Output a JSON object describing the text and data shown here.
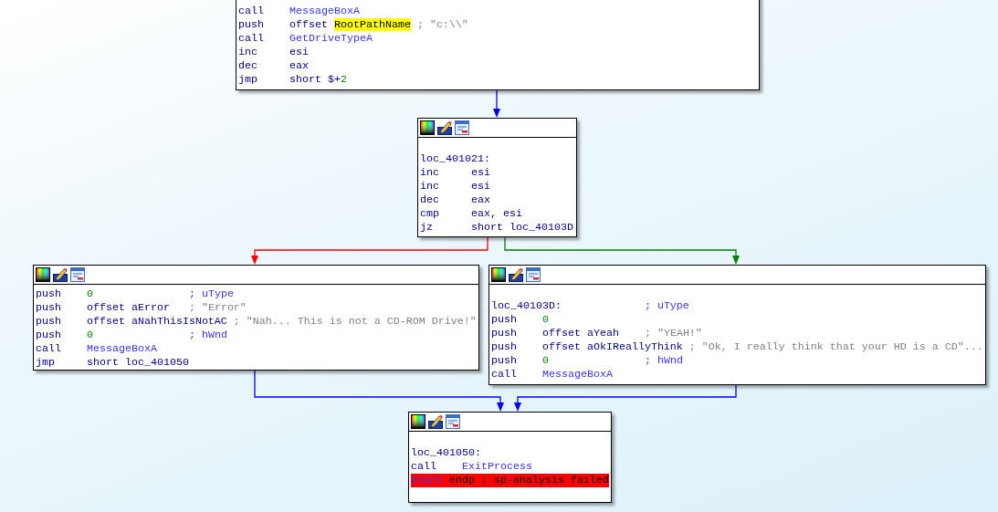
{
  "nodes": [
    {
      "lines": [
        {
          "kind": "instr",
          "mnemonic": "call",
          "operands": [
            {
              "text": "MessageBoxA",
              "kind": "name"
            }
          ]
        },
        {
          "kind": "instr",
          "mnemonic": "push",
          "operands": [
            {
              "text": "offset ",
              "kind": "plain"
            },
            {
              "text": "RootPathName",
              "kind": "highlight"
            }
          ],
          "comment": [
            {
              "text": "; \"c:\\\\\"",
              "kind": "string"
            }
          ]
        },
        {
          "kind": "instr",
          "mnemonic": "call",
          "operands": [
            {
              "text": "GetDriveTypeA",
              "kind": "name"
            }
          ]
        },
        {
          "kind": "instr",
          "mnemonic": "inc",
          "operands": [
            {
              "text": "esi",
              "kind": "plain"
            }
          ]
        },
        {
          "kind": "instr",
          "mnemonic": "dec",
          "operands": [
            {
              "text": "eax",
              "kind": "plain"
            }
          ]
        },
        {
          "kind": "instr",
          "mnemonic": "jmp",
          "operands": [
            {
              "text": "short $+",
              "kind": "plain"
            },
            {
              "text": "2",
              "kind": "number"
            }
          ]
        }
      ]
    },
    {
      "lines": [
        {
          "kind": "label",
          "label": "loc_401021:"
        },
        {
          "kind": "instr",
          "mnemonic": "inc",
          "operands": [
            {
              "text": "esi",
              "kind": "plain"
            }
          ]
        },
        {
          "kind": "instr",
          "mnemonic": "inc",
          "operands": [
            {
              "text": "esi",
              "kind": "plain"
            }
          ]
        },
        {
          "kind": "instr",
          "mnemonic": "dec",
          "operands": [
            {
              "text": "eax",
              "kind": "plain"
            }
          ]
        },
        {
          "kind": "instr",
          "mnemonic": "cmp",
          "operands": [
            {
              "text": "eax, esi",
              "kind": "plain"
            }
          ]
        },
        {
          "kind": "instr",
          "mnemonic": "jz",
          "operands": [
            {
              "text": "short loc_40103D",
              "kind": "plain"
            }
          ]
        }
      ]
    },
    {
      "lines": [
        {
          "kind": "instr",
          "mnemonic": "push",
          "operands": [
            {
              "text": "0",
              "kind": "number"
            }
          ],
          "comment": [
            {
              "text": "; uType",
              "kind": "name"
            }
          ]
        },
        {
          "kind": "instr",
          "mnemonic": "push",
          "operands": [
            {
              "text": "offset aError",
              "kind": "plain"
            }
          ],
          "comment": [
            {
              "text": "; \"Error\"",
              "kind": "string"
            }
          ]
        },
        {
          "kind": "instr",
          "mnemonic": "push",
          "operands": [
            {
              "text": "offset aNahThisIsNotAC",
              "kind": "plain"
            }
          ],
          "comment": [
            {
              "text": "; \"Nah... This is not a CD-ROM Drive!\"",
              "kind": "string"
            }
          ]
        },
        {
          "kind": "instr",
          "mnemonic": "push",
          "operands": [
            {
              "text": "0",
              "kind": "number"
            }
          ],
          "comment": [
            {
              "text": "; hWnd",
              "kind": "name"
            }
          ]
        },
        {
          "kind": "instr",
          "mnemonic": "call",
          "operands": [
            {
              "text": "MessageBoxA",
              "kind": "name"
            }
          ]
        },
        {
          "kind": "instr",
          "mnemonic": "jmp",
          "operands": [
            {
              "text": "short loc_401050",
              "kind": "plain"
            }
          ]
        }
      ]
    },
    {
      "lines": [
        {
          "kind": "label",
          "label": "loc_40103D:",
          "comment": [
            {
              "text": "; uType",
              "kind": "name"
            }
          ]
        },
        {
          "kind": "instr",
          "mnemonic": "push",
          "operands": [
            {
              "text": "0",
              "kind": "number"
            }
          ]
        },
        {
          "kind": "instr",
          "mnemonic": "push",
          "operands": [
            {
              "text": "offset aYeah",
              "kind": "plain"
            }
          ],
          "comment": [
            {
              "text": "; \"YEAH!\"",
              "kind": "string"
            }
          ]
        },
        {
          "kind": "instr",
          "mnemonic": "push",
          "operands": [
            {
              "text": "offset aOkIReallyThink",
              "kind": "plain"
            }
          ],
          "comment": [
            {
              "text": "; \"Ok, I really think that your HD is a CD\"...",
              "kind": "string"
            }
          ]
        },
        {
          "kind": "instr",
          "mnemonic": "push",
          "operands": [
            {
              "text": "0",
              "kind": "number"
            }
          ],
          "comment": [
            {
              "text": "; hWnd",
              "kind": "name"
            }
          ]
        },
        {
          "kind": "instr",
          "mnemonic": "call",
          "operands": [
            {
              "text": "MessageBoxA",
              "kind": "name"
            }
          ]
        }
      ]
    },
    {
      "lines": [
        {
          "kind": "label",
          "label": "loc_401050:"
        },
        {
          "kind": "instr",
          "mnemonic": "call",
          "operands": [
            {
              "text": "ExitProcess",
              "kind": "name"
            }
          ]
        },
        {
          "kind": "error",
          "segments": [
            {
              "text": "start",
              "kind": "name"
            },
            {
              "text": " endp ; sp-analysis failed",
              "kind": "text"
            }
          ]
        }
      ]
    }
  ],
  "edges": [
    {
      "kind": "unconditional"
    },
    {
      "kind": "false"
    },
    {
      "kind": "true"
    },
    {
      "kind": "unconditional"
    },
    {
      "kind": "unconditional"
    }
  ]
}
